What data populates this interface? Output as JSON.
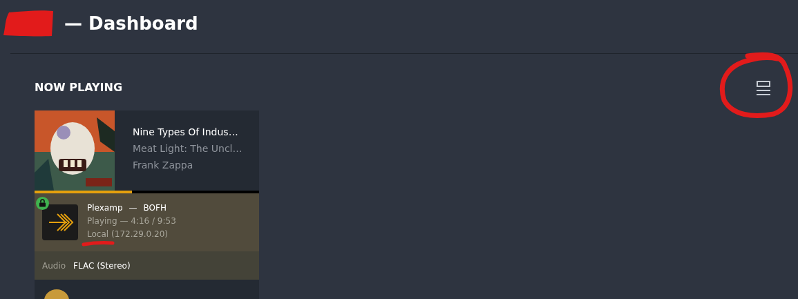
{
  "header": {
    "title": "— Dashboard"
  },
  "section": {
    "title": "NOW PLAYING"
  },
  "sessions": [
    {
      "track": "Nine Types Of Indus…",
      "album": "Meat Light: The Uncl…",
      "artist": "Frank Zappa",
      "progress": {
        "level": 0.434
      },
      "player": "Plexamp",
      "separator": "—",
      "user": "BOFH",
      "state_line": "Playing — 4:16 / 9:53",
      "location": "Local",
      "address": "(172.29.0.20)",
      "details": [
        {
          "label": "Audio",
          "value": "FLAC (Stereo)"
        }
      ]
    }
  ]
}
